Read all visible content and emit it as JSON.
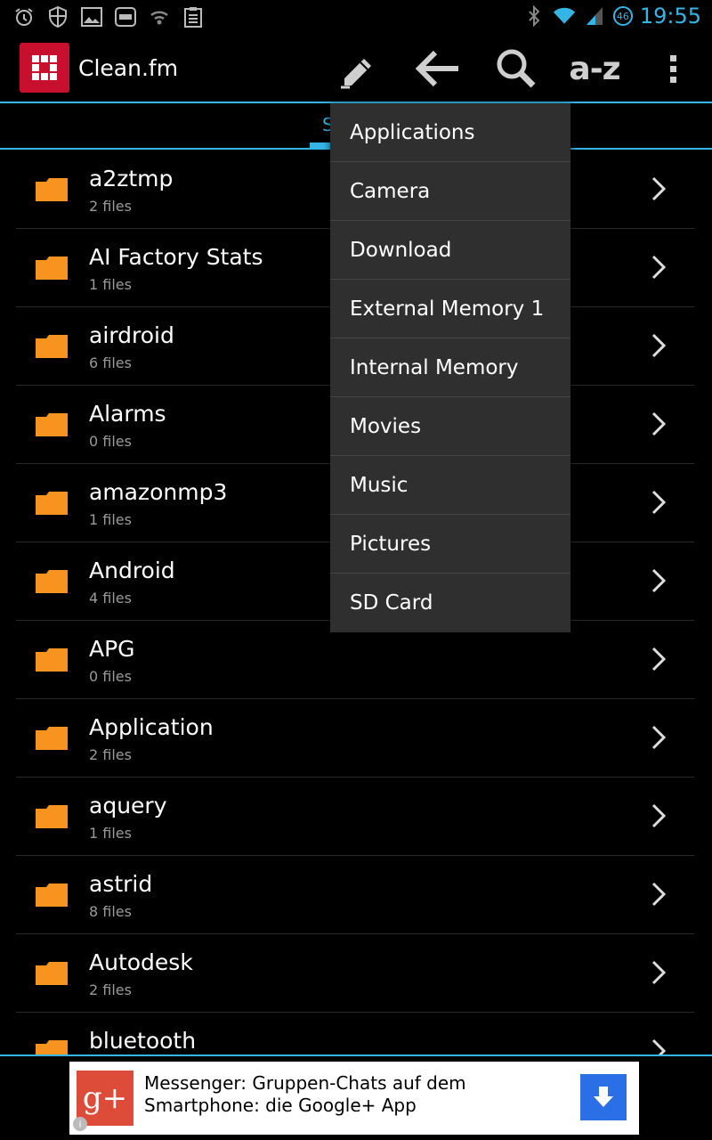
{
  "status_bar": {
    "time": "19:55",
    "network_badge": "46",
    "left_icons": [
      "alarm-icon",
      "shield-icon",
      "gallery-icon",
      "counter-icon",
      "signal-off-icon",
      "clipboard-icon"
    ],
    "right_icons": [
      "bluetooth-icon",
      "wifi-icon",
      "cell-signal-icon"
    ]
  },
  "app_bar": {
    "title": "Clean.fm",
    "sort_label": "a-z",
    "actions": [
      "edit-icon",
      "back-arrow-icon",
      "search-icon",
      "sort-az-icon",
      "overflow-menu-icon"
    ]
  },
  "tabs": {
    "active_label_fragment": "S"
  },
  "dropdown": {
    "items": [
      {
        "label": "Applications"
      },
      {
        "label": "Camera"
      },
      {
        "label": "Download"
      },
      {
        "label": "External Memory 1"
      },
      {
        "label": "Internal Memory"
      },
      {
        "label": "Movies"
      },
      {
        "label": "Music"
      },
      {
        "label": "Pictures"
      },
      {
        "label": "SD Card"
      }
    ]
  },
  "folders": [
    {
      "name": "a2ztmp",
      "count": "2 files"
    },
    {
      "name": "AI Factory Stats",
      "count": "1 files"
    },
    {
      "name": "airdroid",
      "count": "6 files"
    },
    {
      "name": "Alarms",
      "count": "0 files"
    },
    {
      "name": "amazonmp3",
      "count": "1 files"
    },
    {
      "name": "Android",
      "count": "4 files"
    },
    {
      "name": "APG",
      "count": "0 files"
    },
    {
      "name": "Application",
      "count": "2 files"
    },
    {
      "name": "aquery",
      "count": "1 files"
    },
    {
      "name": "astrid",
      "count": "8 files"
    },
    {
      "name": "Autodesk",
      "count": "2 files"
    },
    {
      "name": "bluetooth",
      "count": ""
    }
  ],
  "ad": {
    "text": "Messenger: Gruppen-Chats auf dem Smartphone: die Google+ App",
    "brand_label": "g+",
    "info_label": "i"
  },
  "colors": {
    "accent": "#33b5e5",
    "folder": "#f7931e",
    "app_logo": "#c8102e",
    "dropdown_bg": "#2f2f2f",
    "ad_brand": "#dd4b39",
    "ad_download": "#2a6fe6"
  }
}
